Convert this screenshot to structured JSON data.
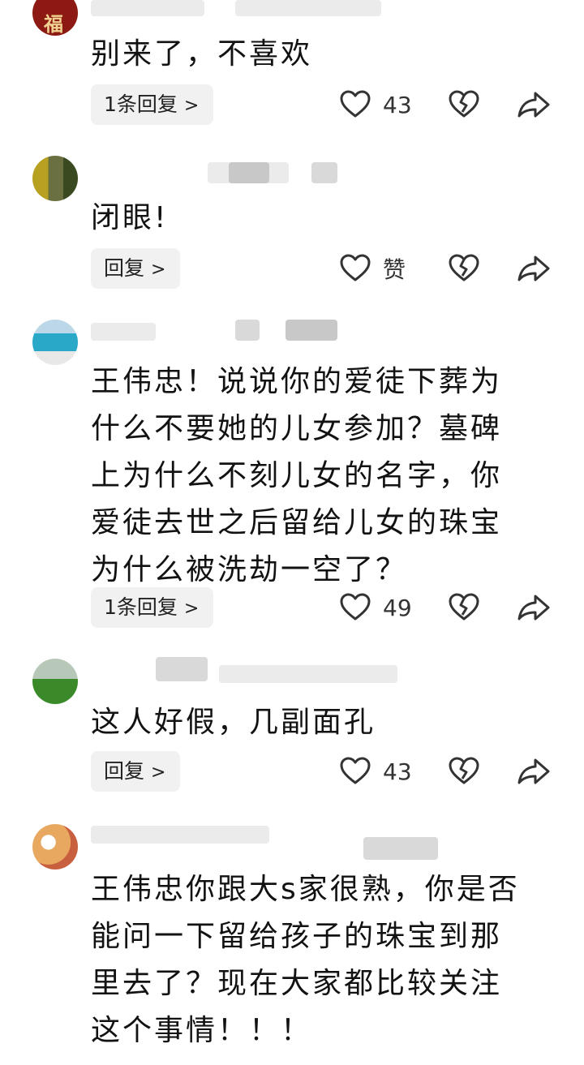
{
  "comments": [
    {
      "text": "别来了，不喜欢",
      "reply_label": "1条回复",
      "like_label": "43",
      "avatar_char": "福"
    },
    {
      "text": "闭眼!",
      "reply_label": "回复",
      "like_label": "赞"
    },
    {
      "text": "王伟忠！说说你的爱徒下葬为\n什么不要她的儿女参加？墓碑\n上为什么不刻儿女的名字，你\n爱徒去世之后留给儿女的珠宝\n为什么被洗劫一空了？",
      "reply_label": "1条回复",
      "like_label": "49"
    },
    {
      "text": "这人好假，几副面孔",
      "reply_label": "回复",
      "like_label": "43"
    },
    {
      "text": "王伟忠你跟大s家很熟，你是否\n能问一下留给孩子的珠宝到那\n里去了？现在大家都比较关注\n这个事情！！！"
    }
  ],
  "icons": {
    "chevron": "chevron-right-icon",
    "like": "heart-icon",
    "dislike": "broken-heart-icon",
    "share": "share-arrow-icon"
  },
  "colors": {
    "icon_stroke": "#333333",
    "reply_bg": "#f1f1f1",
    "avatar1_red": "#8c1a12"
  }
}
